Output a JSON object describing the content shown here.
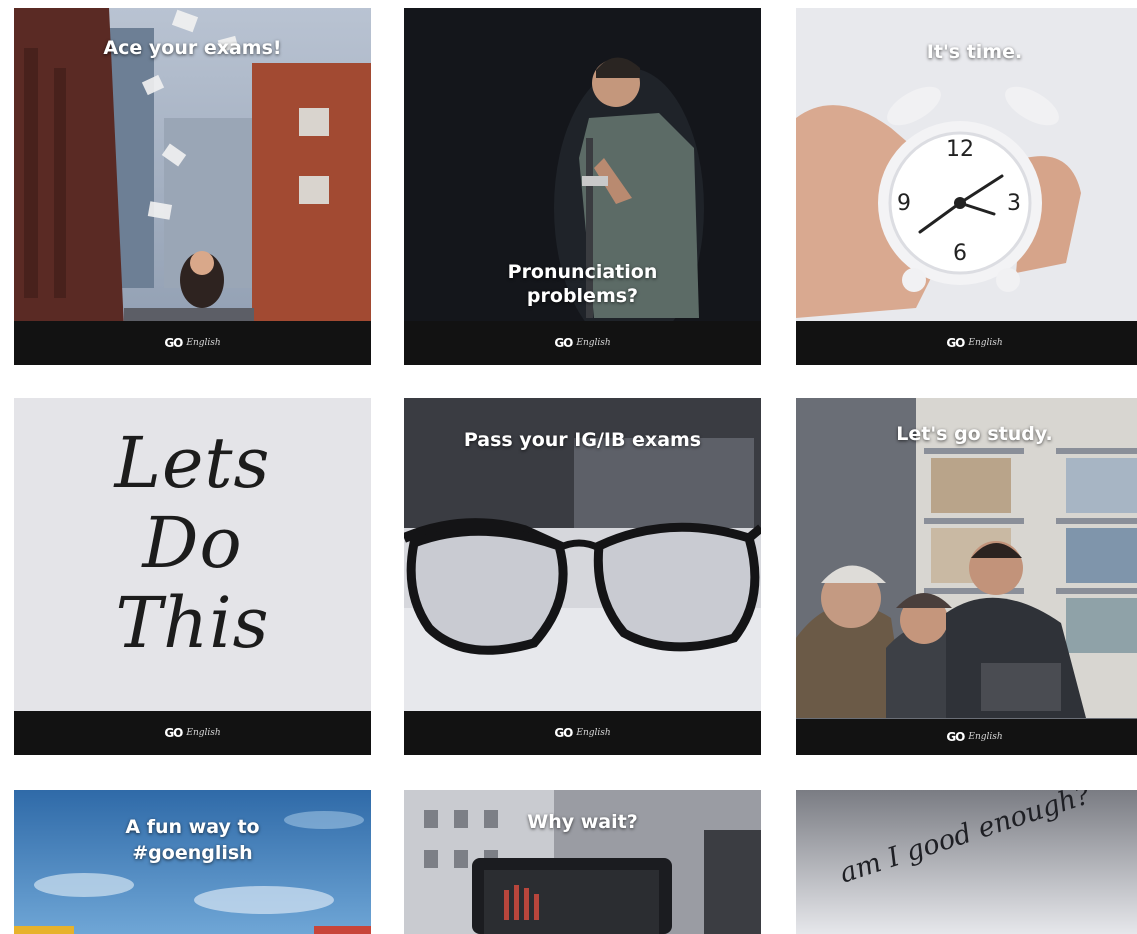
{
  "brand": {
    "mark": "GO",
    "word": "English"
  },
  "tiles": [
    {
      "caption": "Ace your exams!"
    },
    {
      "caption": "Pronunciation problems?"
    },
    {
      "caption": "It's time."
    },
    {
      "caption": "Lets Do This"
    },
    {
      "caption": "Pass your IG/IB exams"
    },
    {
      "caption": "Let's go study."
    },
    {
      "caption": "A fun way to #goenglish"
    },
    {
      "caption": "Why wait?"
    },
    {
      "caption": "am I good enough?"
    }
  ],
  "clock_numbers": [
    "12",
    "3",
    "6",
    "9"
  ],
  "colors": {
    "brand_bar": "#121212",
    "caption": "#ffffff"
  }
}
